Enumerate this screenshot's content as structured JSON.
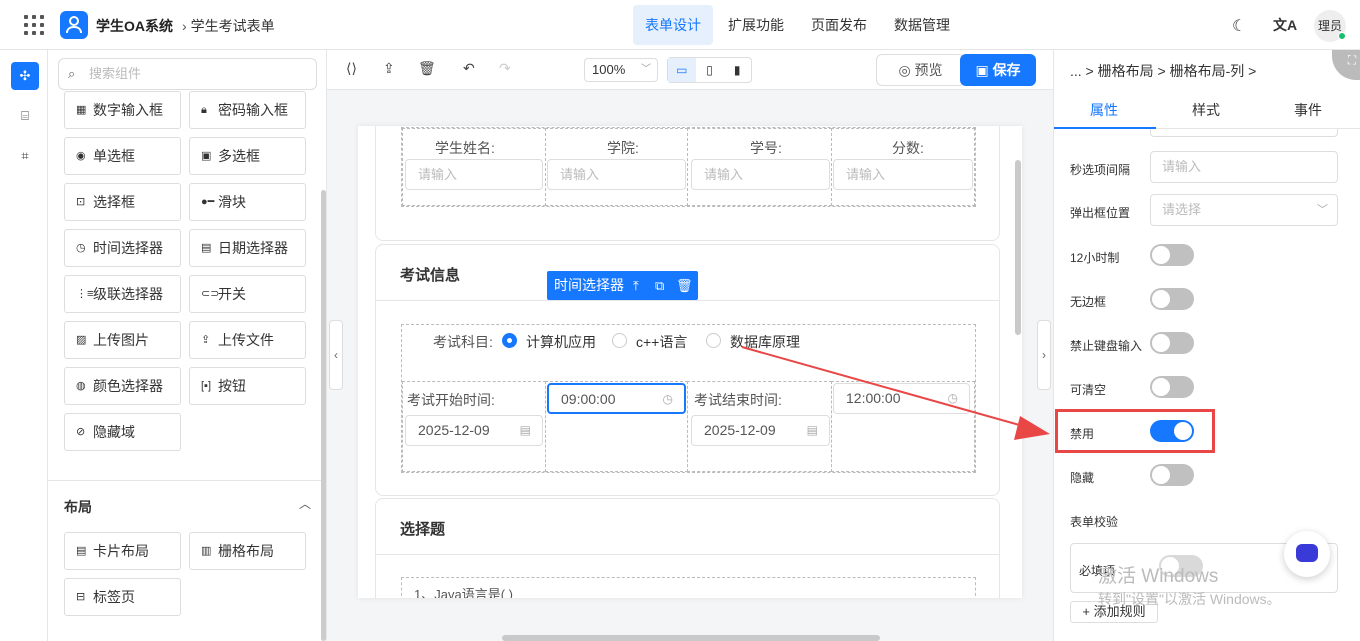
{
  "header": {
    "app_title": "学生OA系统",
    "breadcrumb": "学生考试表单",
    "nav": [
      "表单设计",
      "扩展功能",
      "页面发布",
      "数据管理"
    ],
    "user": "理员"
  },
  "components": {
    "search_placeholder": "搜索组件",
    "items": [
      {
        "label": "数字输入框",
        "icon": "number-icon"
      },
      {
        "label": "密码输入框",
        "icon": "lock-icon"
      },
      {
        "label": "单选框",
        "icon": "radio-icon"
      },
      {
        "label": "多选框",
        "icon": "checkbox-icon"
      },
      {
        "label": "选择框",
        "icon": "select-icon"
      },
      {
        "label": "滑块",
        "icon": "slider-icon"
      },
      {
        "label": "时间选择器",
        "icon": "clock-icon"
      },
      {
        "label": "日期选择器",
        "icon": "calendar-icon"
      },
      {
        "label": "级联选择器",
        "icon": "cascader-icon"
      },
      {
        "label": "开关",
        "icon": "switch-icon"
      },
      {
        "label": "上传图片",
        "icon": "image-icon"
      },
      {
        "label": "上传文件",
        "icon": "upload-icon"
      },
      {
        "label": "颜色选择器",
        "icon": "palette-icon"
      },
      {
        "label": "按钮",
        "icon": "button-icon"
      },
      {
        "label": "隐藏域",
        "icon": "eye-off-icon"
      }
    ],
    "layout_section": "布局",
    "layout_items": [
      {
        "label": "卡片布局",
        "icon": "card-icon"
      },
      {
        "label": "栅格布局",
        "icon": "grid-icon"
      },
      {
        "label": "标签页",
        "icon": "tabs-icon"
      }
    ]
  },
  "toolbar": {
    "zoom": "100%",
    "preview": "预览",
    "save": "保存"
  },
  "form": {
    "student_fields": {
      "labels": [
        "学生姓名:",
        "学院:",
        "学号:",
        "分数:"
      ],
      "placeholder": "请输入"
    },
    "exam_card_title": "考试信息",
    "subject_label": "考试科目:",
    "subject_options": [
      "计算机应用",
      "c++语言",
      "数据库原理"
    ],
    "selected_subject": "计算机应用",
    "selected_component_tag": "时间选择器",
    "start_label": "考试开始时间:",
    "start_time": "09:00:00",
    "start_date": "2025-12-09",
    "end_label": "考试结束时间:",
    "end_time": "12:00:00",
    "end_date": "2025-12-09",
    "choice_card_title": "选择题",
    "question_1": "1、Java语言是( )"
  },
  "properties": {
    "breadcrumb": "... > 栅格布局 > 栅格布局-列 >",
    "tabs": [
      "属性",
      "样式",
      "事件"
    ],
    "active_tab": "属性",
    "second_step_label": "秒选项间隔",
    "second_step_placeholder": "请输入",
    "popup_label": "弹出框位置",
    "popup_placeholder": "请选择",
    "toggles": [
      {
        "label": "12小时制",
        "on": false
      },
      {
        "label": "无边框",
        "on": false
      },
      {
        "label": "禁止键盘输入",
        "on": false
      },
      {
        "label": "可清空",
        "on": false
      },
      {
        "label": "禁用",
        "on": true
      },
      {
        "label": "隐藏",
        "on": false
      }
    ],
    "validation_label": "表单校验",
    "required_label": "必填项",
    "add_rule": "+ 添加规则"
  },
  "overlay": {
    "watermark_title": "激活 Windows",
    "watermark_sub": "转到\"设置\"以激活 Windows。"
  },
  "colors": {
    "accent": "#1677ff",
    "highlight": "#e94646"
  }
}
